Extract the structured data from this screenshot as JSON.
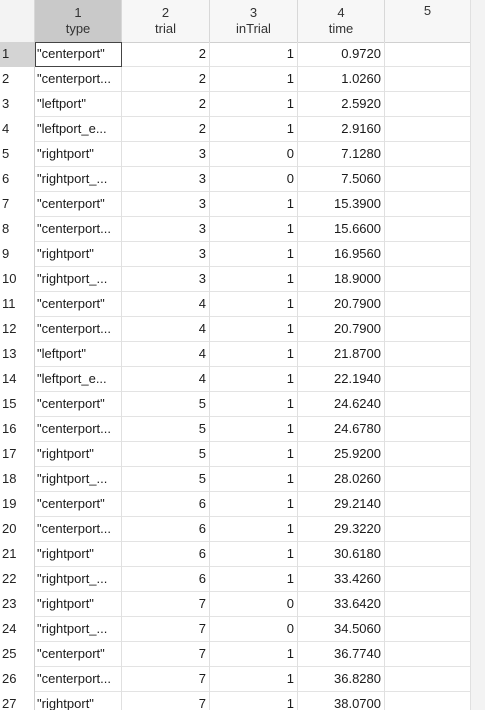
{
  "columns": [
    {
      "num": "1",
      "name": "type"
    },
    {
      "num": "2",
      "name": "trial"
    },
    {
      "num": "3",
      "name": "inTrial"
    },
    {
      "num": "4",
      "name": "time"
    },
    {
      "num": "5",
      "name": ""
    }
  ],
  "rows": [
    {
      "idx": "1",
      "type": "\"centerport\"",
      "trial": "2",
      "inTrial": "1",
      "time": "0.9720"
    },
    {
      "idx": "2",
      "type": "\"centerport...",
      "trial": "2",
      "inTrial": "1",
      "time": "1.0260"
    },
    {
      "idx": "3",
      "type": "\"leftport\"",
      "trial": "2",
      "inTrial": "1",
      "time": "2.5920"
    },
    {
      "idx": "4",
      "type": "\"leftport_e...",
      "trial": "2",
      "inTrial": "1",
      "time": "2.9160"
    },
    {
      "idx": "5",
      "type": "\"rightport\"",
      "trial": "3",
      "inTrial": "0",
      "time": "7.1280"
    },
    {
      "idx": "6",
      "type": "\"rightport_...",
      "trial": "3",
      "inTrial": "0",
      "time": "7.5060"
    },
    {
      "idx": "7",
      "type": "\"centerport\"",
      "trial": "3",
      "inTrial": "1",
      "time": "15.3900"
    },
    {
      "idx": "8",
      "type": "\"centerport...",
      "trial": "3",
      "inTrial": "1",
      "time": "15.6600"
    },
    {
      "idx": "9",
      "type": "\"rightport\"",
      "trial": "3",
      "inTrial": "1",
      "time": "16.9560"
    },
    {
      "idx": "10",
      "type": "\"rightport_...",
      "trial": "3",
      "inTrial": "1",
      "time": "18.9000"
    },
    {
      "idx": "11",
      "type": "\"centerport\"",
      "trial": "4",
      "inTrial": "1",
      "time": "20.7900"
    },
    {
      "idx": "12",
      "type": "\"centerport...",
      "trial": "4",
      "inTrial": "1",
      "time": "20.7900"
    },
    {
      "idx": "13",
      "type": "\"leftport\"",
      "trial": "4",
      "inTrial": "1",
      "time": "21.8700"
    },
    {
      "idx": "14",
      "type": "\"leftport_e...",
      "trial": "4",
      "inTrial": "1",
      "time": "22.1940"
    },
    {
      "idx": "15",
      "type": "\"centerport\"",
      "trial": "5",
      "inTrial": "1",
      "time": "24.6240"
    },
    {
      "idx": "16",
      "type": "\"centerport...",
      "trial": "5",
      "inTrial": "1",
      "time": "24.6780"
    },
    {
      "idx": "17",
      "type": "\"rightport\"",
      "trial": "5",
      "inTrial": "1",
      "time": "25.9200"
    },
    {
      "idx": "18",
      "type": "\"rightport_...",
      "trial": "5",
      "inTrial": "1",
      "time": "28.0260"
    },
    {
      "idx": "19",
      "type": "\"centerport\"",
      "trial": "6",
      "inTrial": "1",
      "time": "29.2140"
    },
    {
      "idx": "20",
      "type": "\"centerport...",
      "trial": "6",
      "inTrial": "1",
      "time": "29.3220"
    },
    {
      "idx": "21",
      "type": "\"rightport\"",
      "trial": "6",
      "inTrial": "1",
      "time": "30.6180"
    },
    {
      "idx": "22",
      "type": "\"rightport_...",
      "trial": "6",
      "inTrial": "1",
      "time": "33.4260"
    },
    {
      "idx": "23",
      "type": "\"rightport\"",
      "trial": "7",
      "inTrial": "0",
      "time": "33.6420"
    },
    {
      "idx": "24",
      "type": "\"rightport_...",
      "trial": "7",
      "inTrial": "0",
      "time": "34.5060"
    },
    {
      "idx": "25",
      "type": "\"centerport\"",
      "trial": "7",
      "inTrial": "1",
      "time": "36.7740"
    },
    {
      "idx": "26",
      "type": "\"centerport...",
      "trial": "7",
      "inTrial": "1",
      "time": "36.8280"
    },
    {
      "idx": "27",
      "type": "\"rightport\"",
      "trial": "7",
      "inTrial": "1",
      "time": "38.0700"
    }
  ]
}
